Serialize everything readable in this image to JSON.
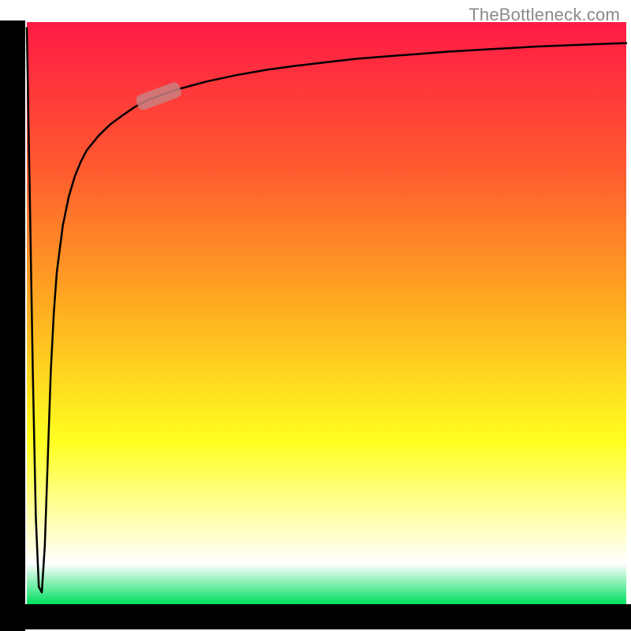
{
  "watermark": "TheBottleneck.com",
  "chart_data": {
    "type": "line",
    "title": "",
    "xlabel": "",
    "ylabel": "",
    "xlim": [
      0,
      100
    ],
    "ylim": [
      0,
      100
    ],
    "grid": false,
    "legend": false,
    "annotations": [
      {
        "type": "marker",
        "x": 22,
        "y": 83,
        "label": "highlighted-segment"
      }
    ],
    "background_gradient": {
      "stops": [
        {
          "pos": 0.0,
          "color": "#ff1a45"
        },
        {
          "pos": 0.25,
          "color": "#ff5a2f"
        },
        {
          "pos": 0.5,
          "color": "#ffb020"
        },
        {
          "pos": 0.72,
          "color": "#ffff20"
        },
        {
          "pos": 0.85,
          "color": "#ffffaa"
        },
        {
          "pos": 0.93,
          "color": "#ffffff"
        },
        {
          "pos": 1.0,
          "color": "#00e060"
        }
      ]
    },
    "series": [
      {
        "name": "bottleneck-curve",
        "x": [
          0,
          0.5,
          1.0,
          1.5,
          2.0,
          2.5,
          3.0,
          3.5,
          4.0,
          4.5,
          5.0,
          6.0,
          7.0,
          8.0,
          9.0,
          10,
          12,
          14,
          16,
          18,
          20,
          22,
          25,
          30,
          35,
          40,
          45,
          50,
          55,
          60,
          65,
          70,
          75,
          80,
          85,
          90,
          95,
          100
        ],
        "y": [
          99,
          70,
          40,
          15,
          3,
          2,
          10,
          25,
          40,
          50,
          57,
          65,
          70,
          73.5,
          76,
          78,
          80.5,
          82.5,
          84,
          85.4,
          86.5,
          87.3,
          88.4,
          89.8,
          90.9,
          91.8,
          92.5,
          93.1,
          93.7,
          94.1,
          94.5,
          94.9,
          95.2,
          95.5,
          95.8,
          96.0,
          96.2,
          96.4
        ]
      }
    ]
  }
}
